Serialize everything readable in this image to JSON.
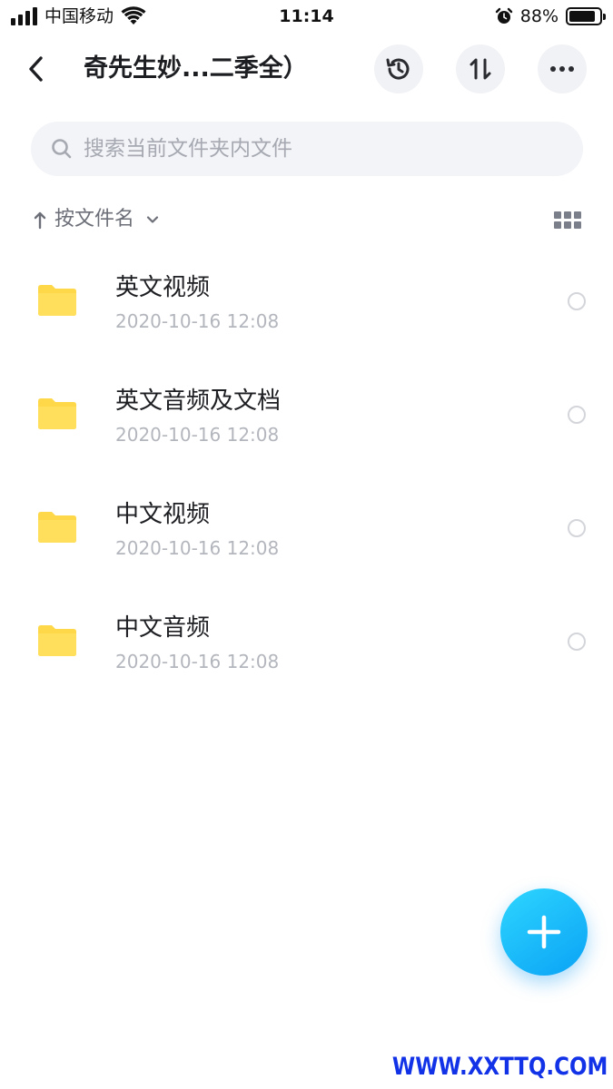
{
  "status_bar": {
    "carrier": "中国移动",
    "time": "11:14",
    "battery_percent": "88%",
    "battery_level": 0.88
  },
  "nav": {
    "title": "奇先生妙...二季全）",
    "back_icon": "chevron-left-icon",
    "history_icon": "history-icon",
    "transfer_icon": "transfer-arrows-icon",
    "more_icon": "more-dots-icon"
  },
  "search": {
    "placeholder": "搜索当前文件夹内文件",
    "value": ""
  },
  "sort": {
    "label": "按文件名",
    "direction_icon": "arrow-up-icon",
    "view_toggle_icon": "grid-view-icon"
  },
  "files": [
    {
      "name": "英文视频",
      "date": "2020-10-16 12:08",
      "type": "folder"
    },
    {
      "name": "英文音频及文档",
      "date": "2020-10-16 12:08",
      "type": "folder"
    },
    {
      "name": "中文视频",
      "date": "2020-10-16 12:08",
      "type": "folder"
    },
    {
      "name": "中文音频",
      "date": "2020-10-16 12:08",
      "type": "folder"
    }
  ],
  "fab": {
    "icon": "plus-icon",
    "color": "#0aa2f5"
  },
  "watermark": "WWW.XXTTQ.COM",
  "colors": {
    "folder": "#ffd84a",
    "accent": "#19b8fb",
    "watermark": "#1232e8"
  }
}
